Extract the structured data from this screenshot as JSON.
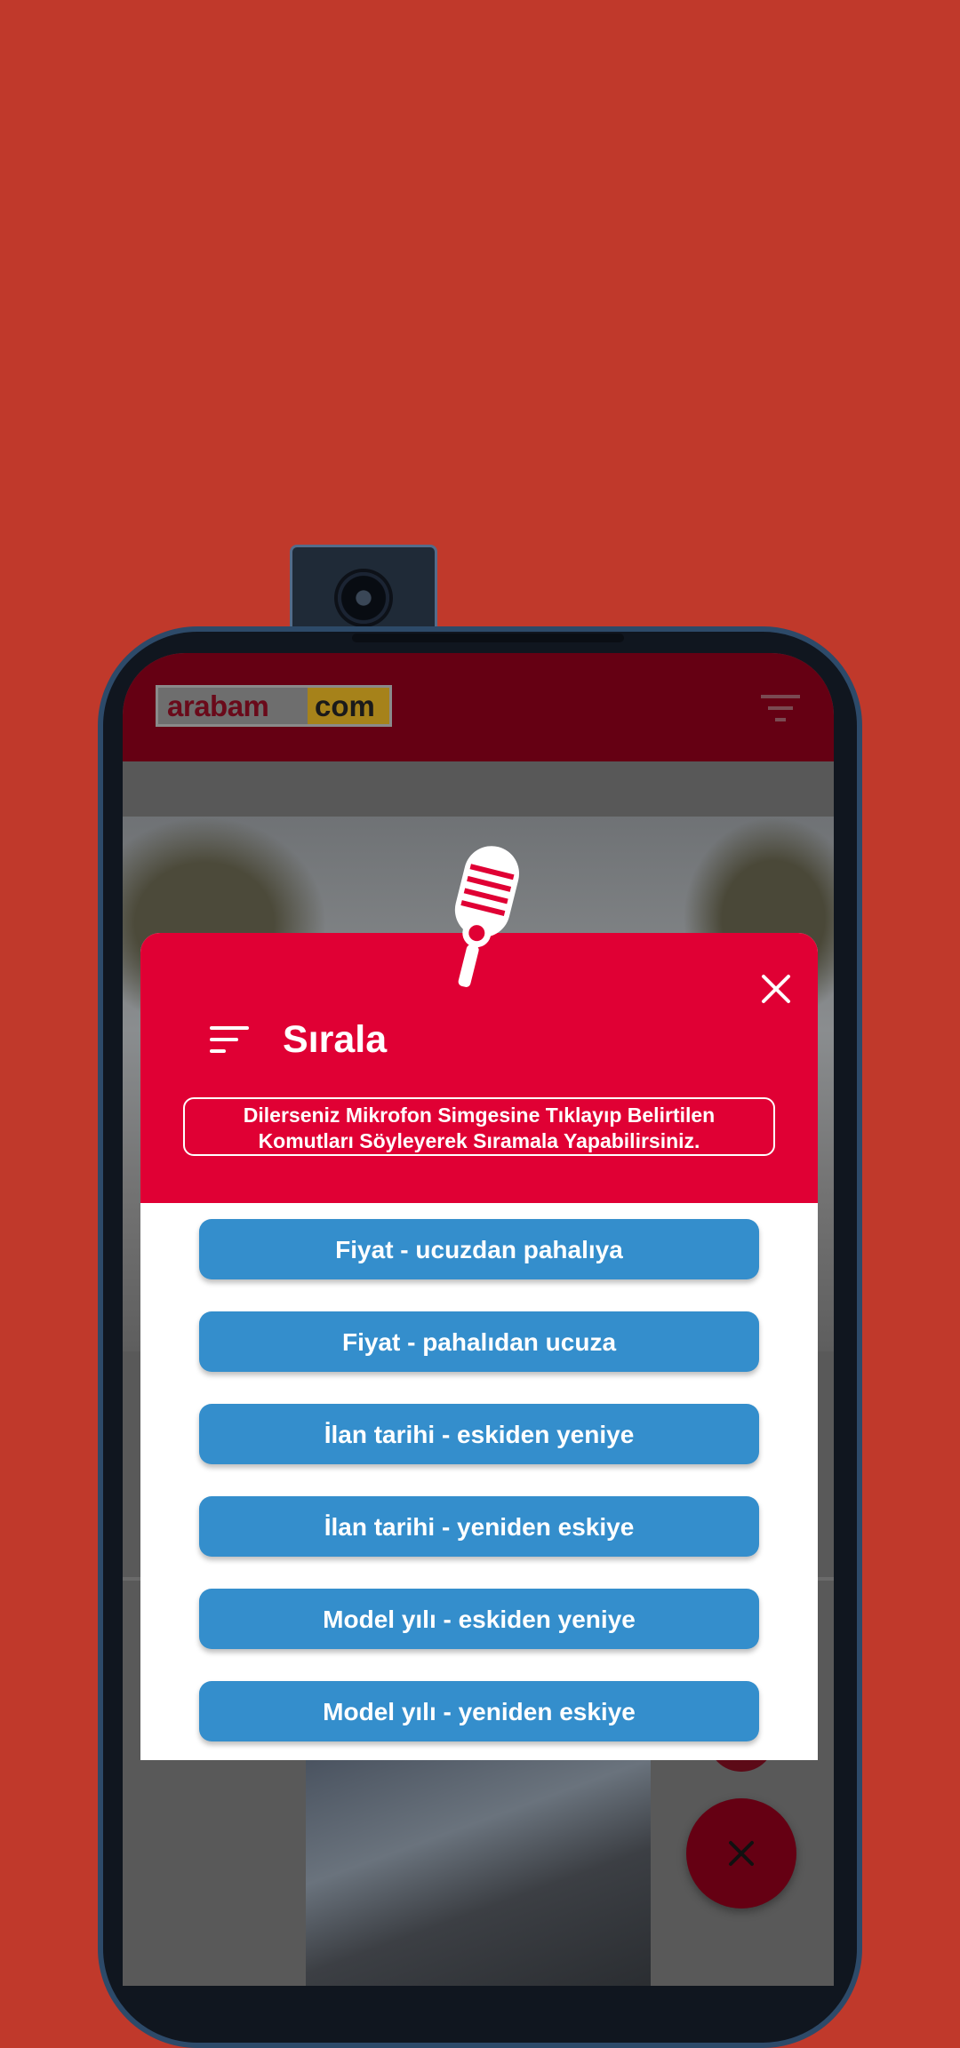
{
  "app": {
    "logo_left": "arabam",
    "logo_right": "com"
  },
  "dialog": {
    "title": "Sırala",
    "hint_line1": "Dilerseniz Mikrofon Simgesine Tıklayıp Belirtilen",
    "hint_line2": "Komutları Söyleyerek Sıramala Yapabilirsiniz.",
    "options": [
      "Fiyat - ucuzdan pahalıya",
      "Fiyat - pahalıdan ucuza",
      "İlan tarihi - eskiden yeniye",
      "İlan tarihi - yeniden eskiye",
      "Model yılı - eskiden yeniye",
      "Model yılı - yeniden eskiye"
    ]
  },
  "colors": {
    "background": "#c0392b",
    "appbar": "#650013",
    "dialog_header": "#e00034",
    "option_button": "#348ecc",
    "fab": "#650013"
  },
  "icons": [
    "microphone-icon",
    "close-icon",
    "sort-icon",
    "filter-icon",
    "fab-close-icon"
  ]
}
